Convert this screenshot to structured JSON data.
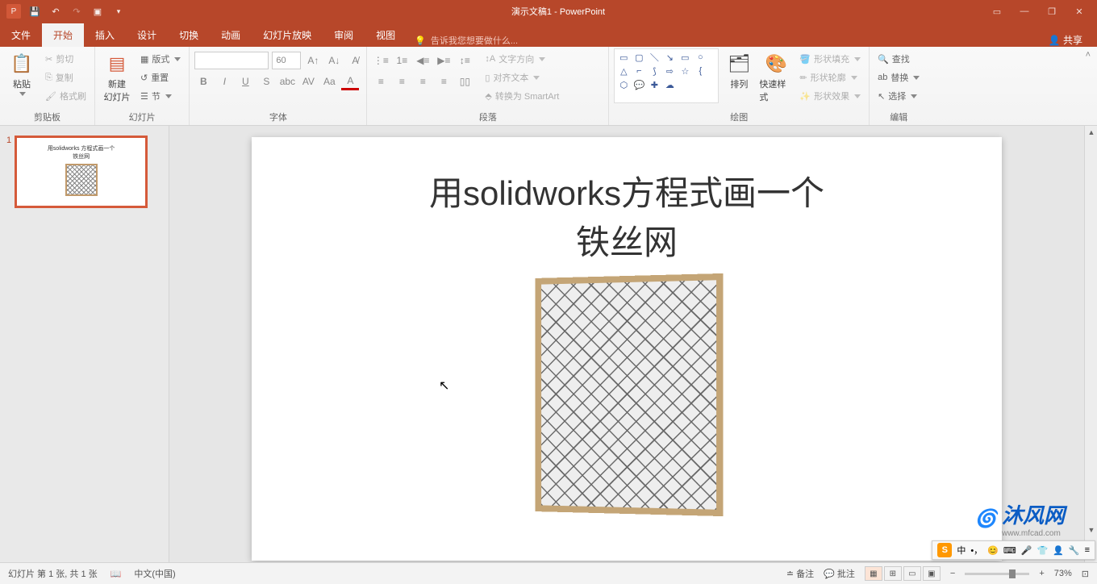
{
  "titlebar": {
    "title": "演示文稿1 - PowerPoint"
  },
  "tabs": {
    "file": "文件",
    "home": "开始",
    "insert": "插入",
    "design": "设计",
    "transitions": "切换",
    "animations": "动画",
    "slideshow": "幻灯片放映",
    "review": "审阅",
    "view": "视图",
    "tellme": "告诉我您想要做什么...",
    "share": "共享"
  },
  "ribbon": {
    "clipboard": {
      "label": "剪贴板",
      "paste": "粘贴",
      "cut": "剪切",
      "copy": "复制",
      "format_painter": "格式刷"
    },
    "slides": {
      "label": "幻灯片",
      "new_slide": "新建\n幻灯片",
      "layout": "版式",
      "reset": "重置",
      "section": "节"
    },
    "font": {
      "label": "字体",
      "size": "60"
    },
    "paragraph": {
      "label": "段落",
      "text_direction": "文字方向",
      "align_text": "对齐文本",
      "convert_smartart": "转换为 SmartArt"
    },
    "drawing": {
      "label": "绘图",
      "arrange": "排列",
      "quick_styles": "快速样式",
      "shape_fill": "形状填充",
      "shape_outline": "形状轮廓",
      "shape_effects": "形状效果"
    },
    "editing": {
      "label": "编辑",
      "find": "查找",
      "replace": "替换",
      "select": "选择"
    }
  },
  "slide": {
    "title_line1": "用solidworks方程式画一个",
    "title_line2": "铁丝网",
    "thumb_title": "用solidworks 方程式画一个\n铁丝网"
  },
  "watermark": {
    "brand": "沐风网",
    "url": "www.mfcad.com"
  },
  "status": {
    "slide_info": "幻灯片 第 1 张, 共 1 张",
    "lang": "中文(中国)",
    "notes": "备注",
    "comments": "批注",
    "zoom": "73%"
  },
  "ime": {
    "mode": "中"
  }
}
